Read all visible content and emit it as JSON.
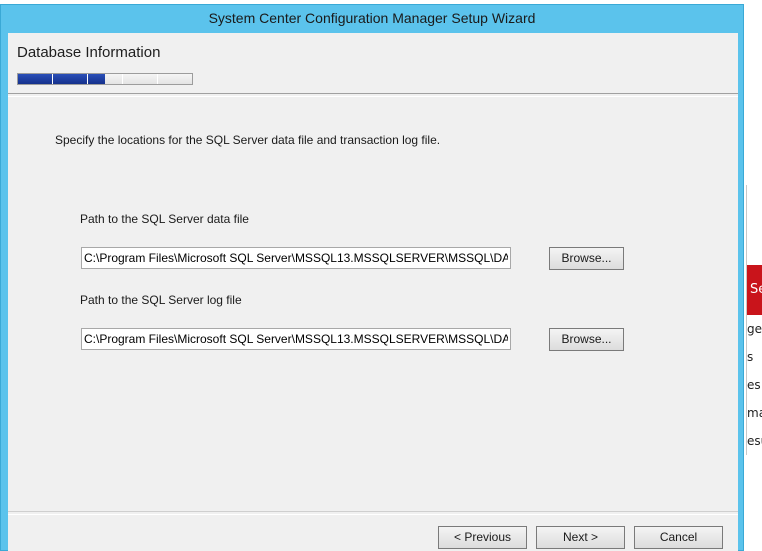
{
  "window": {
    "title": "System Center Configuration Manager Setup Wizard"
  },
  "header": {
    "title": "Database Information",
    "progress_segments": 5,
    "progress_filled": 2.5
  },
  "content": {
    "instruction": "Specify the locations for the SQL Server data file and transaction log file.",
    "data_file": {
      "label": "Path to the SQL Server data file",
      "value": "C:\\Program Files\\Microsoft SQL Server\\MSSQL13.MSSQLSERVER\\MSSQL\\DATA\\",
      "browse_label": "Browse..."
    },
    "log_file": {
      "label": "Path to the SQL Server log file",
      "value": "C:\\Program Files\\Microsoft SQL Server\\MSSQL13.MSSQLSERVER\\MSSQL\\DATA\\",
      "browse_label": "Browse..."
    }
  },
  "footer": {
    "previous_label": "< Previous",
    "next_label": "Next >",
    "cancel_label": "Cancel"
  },
  "background": {
    "red_block_text": "Se",
    "lines": [
      "gea",
      "s",
      "es",
      "ma",
      "esu"
    ]
  },
  "colors": {
    "titlebar": "#5bc3ec",
    "progress_fill": "#1c3a9e",
    "background_red": "#c9141b"
  }
}
